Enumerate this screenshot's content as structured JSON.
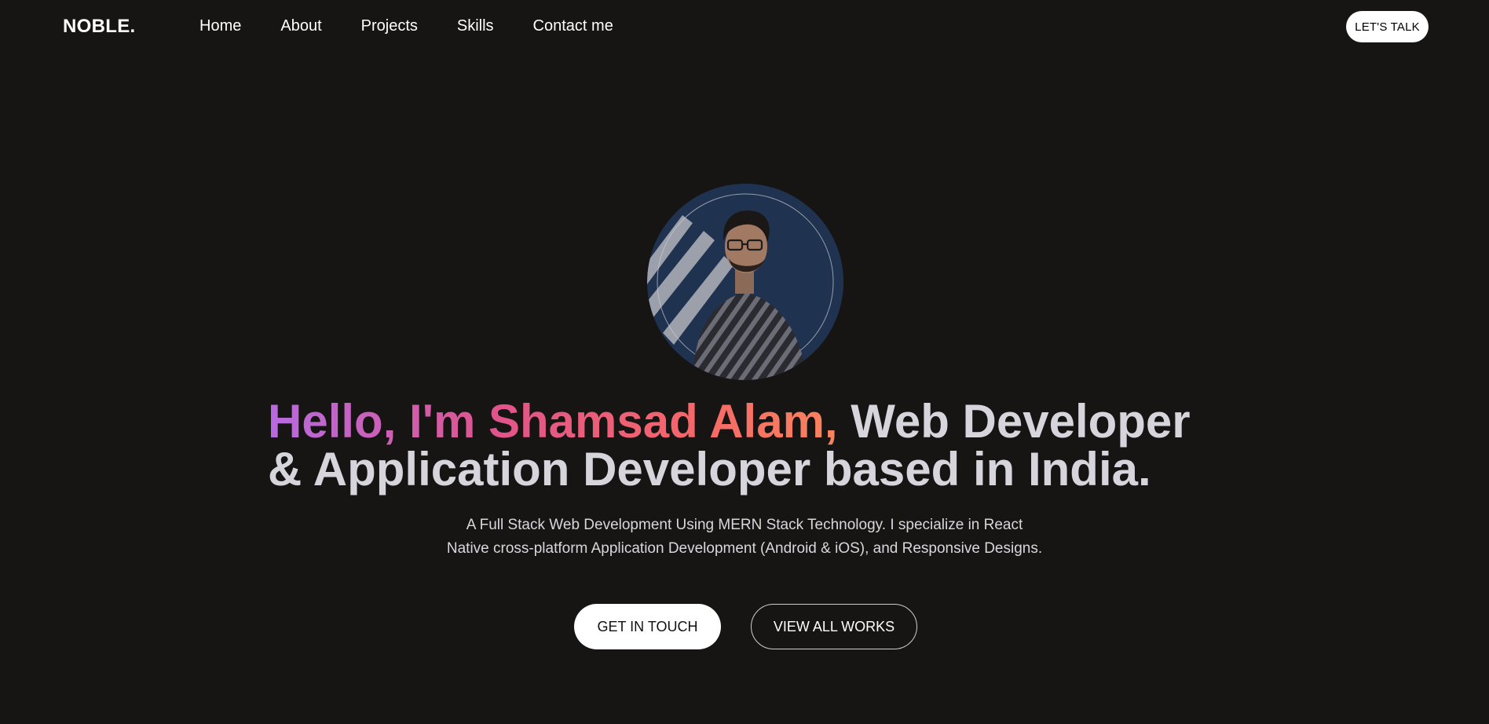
{
  "nav": {
    "logo": "NOBLE.",
    "links": [
      {
        "label": "Home"
      },
      {
        "label": "About"
      },
      {
        "label": "Projects"
      },
      {
        "label": "Skills"
      },
      {
        "label": "Contact me"
      }
    ],
    "cta_label": "LET'S TALK"
  },
  "hero": {
    "headline_highlight": "Hello, I'm Shamsad Alam,",
    "headline_rest": " Web Developer & Application Developer based in India.",
    "intro": "A Full Stack Web Development Using MERN Stack Technology. I specialize in React Native cross-platform Application Development (Android & iOS), and Responsive Designs.",
    "primary_button": "GET IN TOUCH",
    "secondary_button": "VIEW ALL WORKS"
  },
  "colors": {
    "background": "#161514",
    "headline_text": "#d6d5dc",
    "gradient_start": "#b66be0",
    "gradient_mid": "#e0548c",
    "gradient_end": "#f9845d",
    "avatar_bg": "#1e2f48"
  }
}
